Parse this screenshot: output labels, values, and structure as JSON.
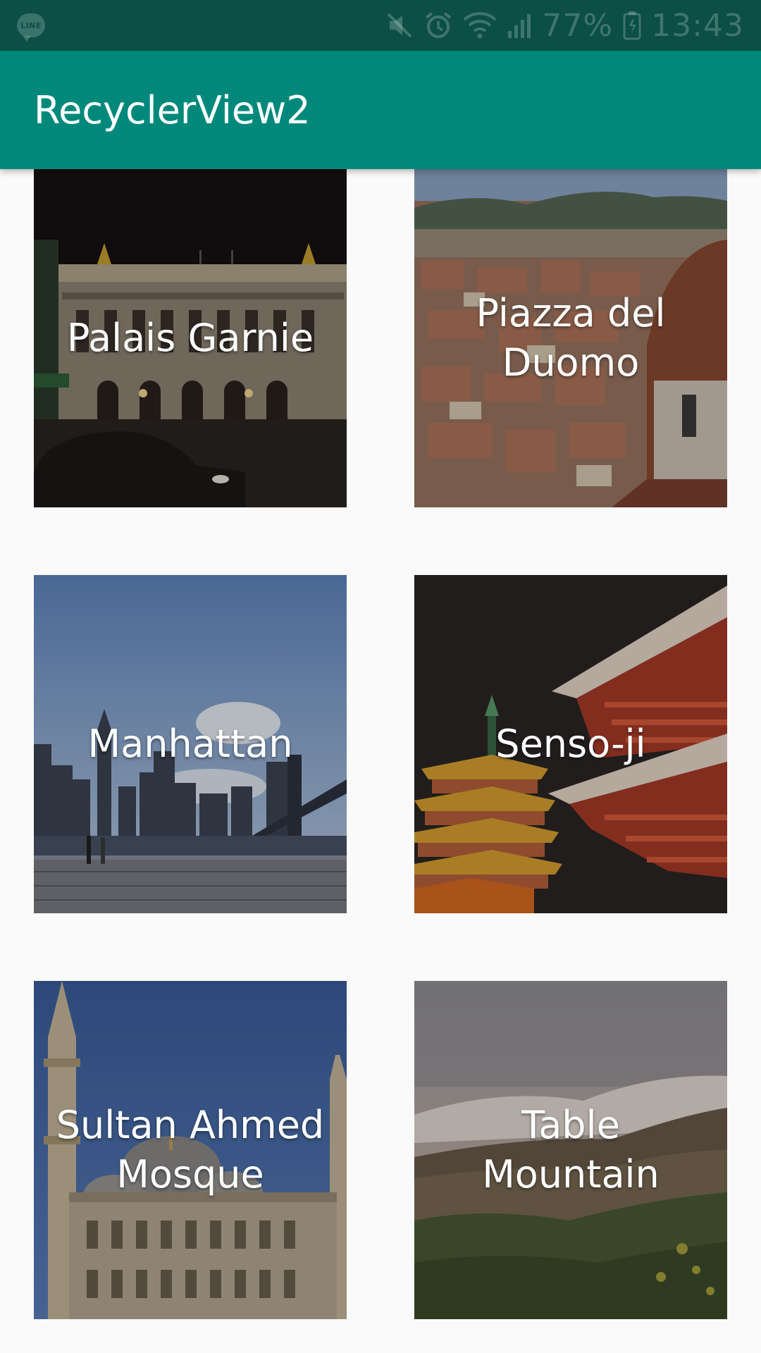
{
  "status_bar": {
    "notification_icon_text": "LINE",
    "battery_percent": "77%",
    "time": "13:43"
  },
  "app_bar": {
    "title": "RecyclerView2"
  },
  "places": [
    {
      "label": "Palais Garnie"
    },
    {
      "label": "Piazza del Duomo"
    },
    {
      "label": "Manhattan"
    },
    {
      "label": "Senso-ji"
    },
    {
      "label": "Sultan Ahmed Mosque"
    },
    {
      "label": "Table Mountain"
    }
  ],
  "colors": {
    "status_bar": "#0b4f46",
    "app_bar": "#00897b",
    "background": "#fafafa"
  }
}
